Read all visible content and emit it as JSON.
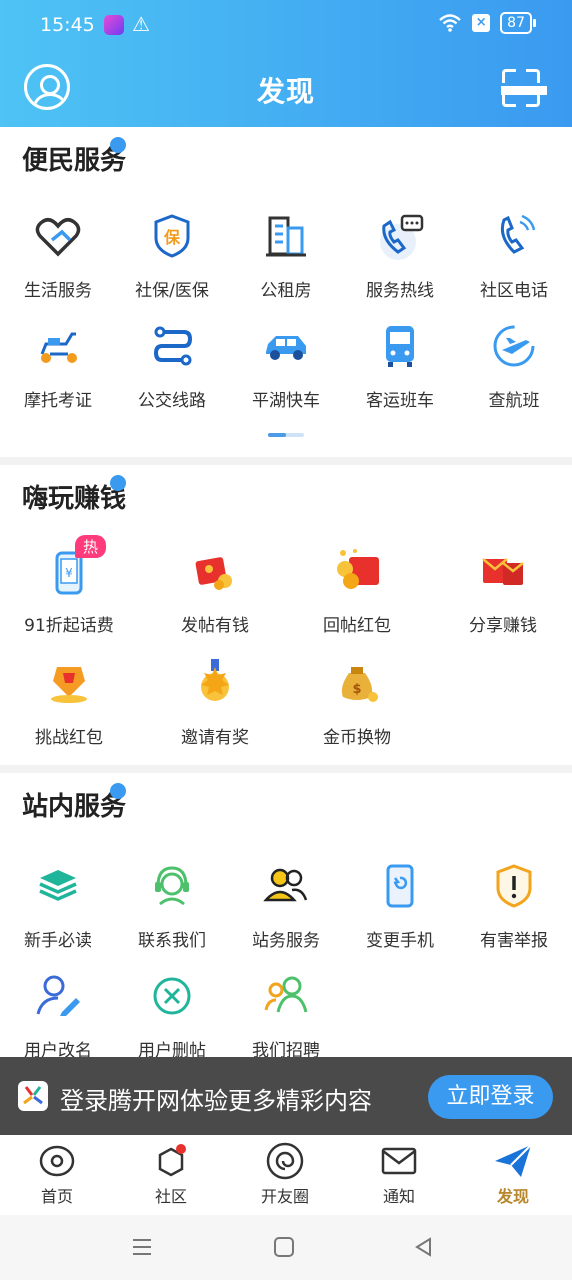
{
  "status": {
    "time": "15:45",
    "battery": "87"
  },
  "header": {
    "title": "发现"
  },
  "sections": [
    {
      "title": "便民服务",
      "items": [
        {
          "label": "生活服务",
          "icon": "heart-handshake-icon"
        },
        {
          "label": "社保/医保",
          "icon": "shield-insurance-icon"
        },
        {
          "label": "公租房",
          "icon": "building-icon"
        },
        {
          "label": "服务热线",
          "icon": "phone-chat-icon"
        },
        {
          "label": "社区电话",
          "icon": "phone-call-icon"
        },
        {
          "label": "摩托考证",
          "icon": "scooter-icon"
        },
        {
          "label": "公交线路",
          "icon": "route-icon"
        },
        {
          "label": "平湖快车",
          "icon": "car-icon"
        },
        {
          "label": "客运班车",
          "icon": "bus-icon"
        },
        {
          "label": "查航班",
          "icon": "plane-icon"
        }
      ]
    },
    {
      "title": "嗨玩赚钱",
      "items": [
        {
          "label": "91折起话费",
          "icon": "phone-recharge-icon",
          "badge": "热"
        },
        {
          "label": "发帖有钱",
          "icon": "red-envelope-icon"
        },
        {
          "label": "回帖红包",
          "icon": "red-envelope-coins-icon"
        },
        {
          "label": "分享赚钱",
          "icon": "share-envelope-icon"
        },
        {
          "label": "挑战红包",
          "icon": "trophy-envelope-icon"
        },
        {
          "label": "邀请有奖",
          "icon": "medal-icon"
        },
        {
          "label": "金币换物",
          "icon": "money-bag-icon"
        }
      ]
    },
    {
      "title": "站内服务",
      "items": [
        {
          "label": "新手必读",
          "icon": "book-stack-icon"
        },
        {
          "label": "联系我们",
          "icon": "headset-icon"
        },
        {
          "label": "站务服务",
          "icon": "users-icon"
        },
        {
          "label": "变更手机",
          "icon": "phone-change-icon"
        },
        {
          "label": "有害举报",
          "icon": "warning-shield-icon"
        },
        {
          "label": "用户改名",
          "icon": "user-edit-icon"
        },
        {
          "label": "用户删帖",
          "icon": "delete-circle-icon"
        },
        {
          "label": "我们招聘",
          "icon": "recruit-users-icon"
        }
      ]
    }
  ],
  "login_bar": {
    "message": "登录腾开网体验更多精彩内容",
    "button": "立即登录"
  },
  "tabs": [
    {
      "label": "首页",
      "icon": "eye-icon"
    },
    {
      "label": "社区",
      "icon": "community-hexagon-icon"
    },
    {
      "label": "开友圈",
      "icon": "spiral-icon"
    },
    {
      "label": "通知",
      "icon": "mail-icon"
    },
    {
      "label": "发现",
      "icon": "paper-plane-icon"
    }
  ],
  "colors": {
    "accent": "#3a9af0",
    "header_start": "#4ec3f4",
    "active_tab": "#1a73d8"
  }
}
